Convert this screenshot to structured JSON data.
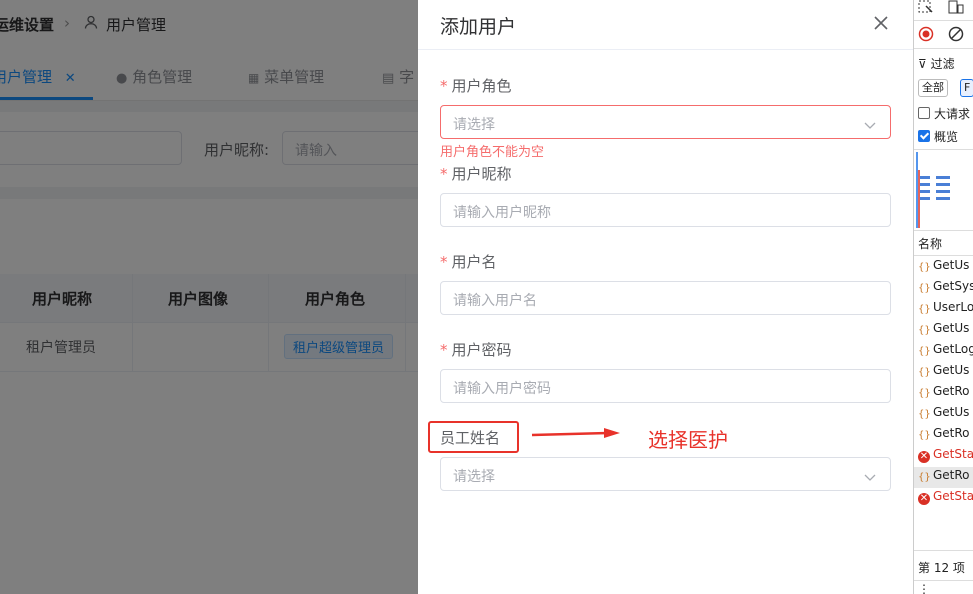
{
  "breadcrumb": {
    "parent": "运维设置",
    "current": "用户管理"
  },
  "tabs": [
    {
      "label": "用户管理"
    },
    {
      "label": "角色管理"
    },
    {
      "label": "菜单管理"
    },
    {
      "label": "字"
    }
  ],
  "search": {
    "nickname_label": "用户昵称:",
    "nickname_placeholder": "请输入"
  },
  "table": {
    "headers": [
      "用户昵称",
      "用户图像",
      "用户角色"
    ],
    "rows": [
      {
        "nickname": "租户管理员",
        "avatar": "",
        "role": "租户超级管理员"
      }
    ]
  },
  "dialog": {
    "title": "添加用户",
    "fields": [
      {
        "label": "用户角色",
        "required": "*",
        "placeholder": "请选择",
        "error": "用户角色不能为空"
      },
      {
        "label": "用户昵称",
        "required": "*",
        "placeholder": "请输入用户昵称"
      },
      {
        "label": "用户名",
        "required": "*",
        "placeholder": "请输入用户名"
      },
      {
        "label": "用户密码",
        "required": "*",
        "placeholder": "请输入用户密码"
      },
      {
        "label": "员工姓名",
        "placeholder": "请选择"
      }
    ]
  },
  "annotation": {
    "text": "选择医护",
    "color": "#e8322a"
  },
  "devtools": {
    "filter_label": "过滤",
    "all_button": "全部",
    "f_button": "F",
    "big_requests": "大请求",
    "overview": "概览",
    "name_header": "名称",
    "requests": [
      {
        "name": "GetUs",
        "status": "ok"
      },
      {
        "name": "GetSys",
        "status": "ok"
      },
      {
        "name": "UserLo",
        "status": "ok"
      },
      {
        "name": "GetUs",
        "status": "ok"
      },
      {
        "name": "GetLog",
        "status": "ok"
      },
      {
        "name": "GetUs",
        "status": "ok"
      },
      {
        "name": "GetRo",
        "status": "ok"
      },
      {
        "name": "GetUs",
        "status": "ok"
      },
      {
        "name": "GetRo",
        "status": "ok"
      },
      {
        "name": "GetSta",
        "status": "error"
      },
      {
        "name": "GetRo",
        "status": "ok"
      },
      {
        "name": "GetSta",
        "status": "error"
      }
    ],
    "footer": "第 12 项"
  },
  "colors": {
    "accent": "#1890ff",
    "error": "#f56c6c",
    "annotation": "#e8322a"
  }
}
